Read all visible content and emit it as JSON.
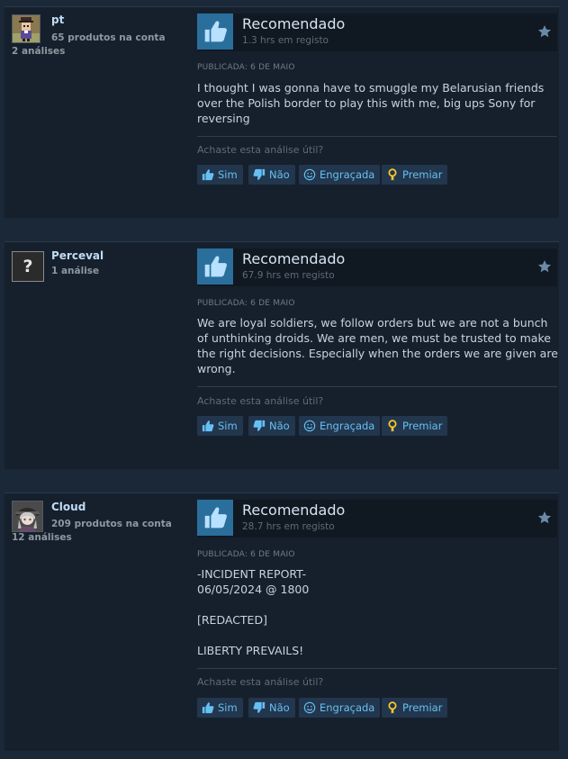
{
  "helpful_question": "Achaste esta análise útil?",
  "buttons": {
    "yes": "Sim",
    "no": "Não",
    "funny": "Engraçada",
    "award": "Premiar"
  },
  "colors": {
    "background": "#1b2838",
    "panel": "#16202d",
    "accent": "#66c0f4",
    "thumb_box": "#2a6e9c",
    "award_icon": "#ffc82c"
  },
  "reviews": [
    {
      "author": {
        "name": "pt",
        "products": "65 produtos na conta",
        "reviews": "2 análises",
        "avatar": "pixel-avatar"
      },
      "recommendation": "Recomendado",
      "hours": "1.3 hrs em registo",
      "posted": "PUBLICADA: 6 DE MAIO",
      "lines": [
        "I thought I was gonna have to smuggle my Belarusian friends",
        "over the Polish border to play this with me, big ups Sony for",
        "reversing"
      ]
    },
    {
      "author": {
        "name": "Perceval",
        "products": "",
        "reviews": "1 análise",
        "avatar": "question-mark-avatar",
        "avatar_text": "?"
      },
      "recommendation": "Recomendado",
      "hours": "67.9 hrs em registo",
      "posted": "PUBLICADA: 6 DE MAIO",
      "lines": [
        "We are loyal soldiers, we follow orders but we are not a bunch",
        "of unthinking droids. We are men, we must be trusted to make",
        "the right decisions. Especially when the orders we are given are",
        "wrong."
      ]
    },
    {
      "author": {
        "name": "Cloud",
        "products": "209 produtos na conta",
        "reviews": "12 análises",
        "avatar": "anime-character-avatar"
      },
      "recommendation": "Recomendado",
      "hours": "28.7 hrs em registo",
      "posted": "PUBLICADA: 6 DE MAIO",
      "lines": [
        "-INCIDENT REPORT-",
        "06/05/2024 @ 1800",
        "",
        "[REDACTED]",
        "",
        "LIBERTY PREVAILS!"
      ]
    }
  ]
}
